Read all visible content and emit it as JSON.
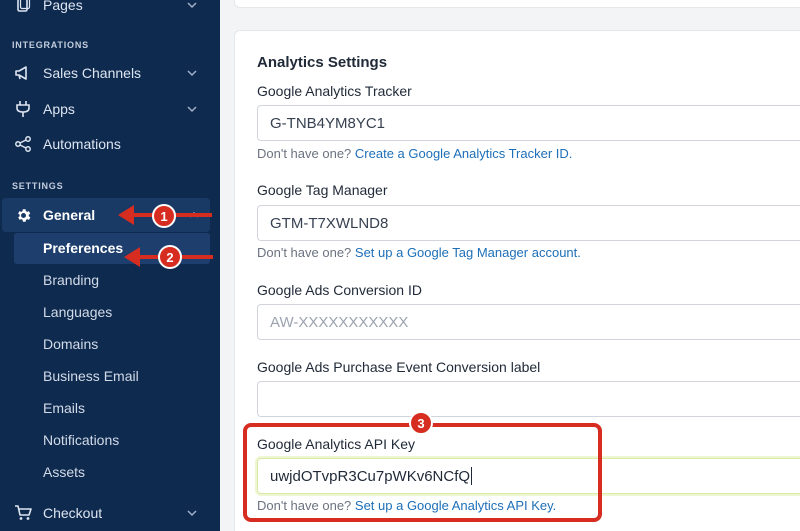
{
  "sidebar": {
    "pages_label": "Pages",
    "integrations_heading": "INTEGRATIONS",
    "sales_channels": "Sales Channels",
    "apps": "Apps",
    "automations": "Automations",
    "settings_heading": "SETTINGS",
    "general": "General",
    "sub_items": [
      "Preferences",
      "Branding",
      "Languages",
      "Domains",
      "Business Email",
      "Emails",
      "Notifications",
      "Assets"
    ],
    "checkout": "Checkout"
  },
  "analytics": {
    "title": "Analytics Settings",
    "tracker_label": "Google Analytics Tracker",
    "tracker_value": "G-TNB4YM8YC1",
    "tracker_help_prefix": "Don't have one?",
    "tracker_help_link": "Create a Google Analytics Tracker ID.",
    "gtm_label": "Google Tag Manager",
    "gtm_value": "GTM-T7XWLND8",
    "gtm_help_prefix": "Don't have one?",
    "gtm_help_link": "Set up a Google Tag Manager account.",
    "ads_label": "Google Ads Conversion ID",
    "ads_placeholder": "AW-XXXXXXXXXXX",
    "purchase_label": "Google Ads Purchase Event Conversion label",
    "purchase_value": "",
    "api_label": "Google Analytics API Key",
    "api_value": "uwjdOTvpR3Cu7pWKv6NCfQ",
    "api_help_prefix": "Don't have one?",
    "api_help_link": "Set up a Google Analytics API Key."
  },
  "annotations": {
    "step1": "1",
    "step2": "2",
    "step3": "3",
    "color": "#d62d20"
  }
}
